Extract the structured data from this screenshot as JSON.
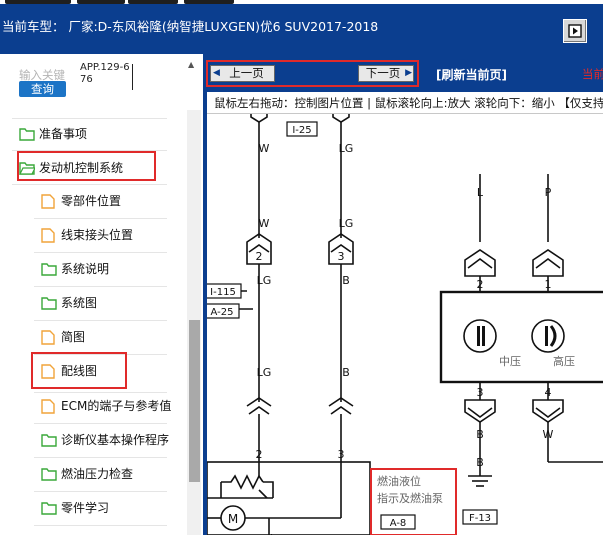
{
  "header": {
    "title": "当前车型： 厂家:D-东风裕隆(纳智捷LUXGEN)优6 SUV2017-2018"
  },
  "search": {
    "label": "输入关键",
    "code": "APP.129-676",
    "button": "查询"
  },
  "sidebar": {
    "items": [
      {
        "label": "准备事项",
        "icon": "folder-icon"
      },
      {
        "label": "发动机控制系统",
        "icon": "folder-open-icon"
      },
      {
        "label": "零部件位置",
        "icon": "document-icon"
      },
      {
        "label": "线束接头位置",
        "icon": "document-icon"
      },
      {
        "label": "系统说明",
        "icon": "folder-icon"
      },
      {
        "label": "系统图",
        "icon": "folder-icon"
      },
      {
        "label": "简图",
        "icon": "document-icon"
      },
      {
        "label": "配线图",
        "icon": "document-icon"
      },
      {
        "label": "ECM的端子与参考值",
        "icon": "document-icon"
      },
      {
        "label": "诊断仪基本操作程序",
        "icon": "folder-icon"
      },
      {
        "label": "燃油压力检查",
        "icon": "folder-icon"
      },
      {
        "label": "零件学习",
        "icon": "folder-icon"
      }
    ]
  },
  "toolbar": {
    "prev": "上一页",
    "next": "下一页",
    "refresh": "[刷新当前页]",
    "current": "当前"
  },
  "hint": "鼠标左右拖动：控制图片位置 | 鼠标滚轮向上:放大  滚轮向下：缩小 【仅支持IE浏览器】",
  "diagram": {
    "connectors": {
      "top": "I-25",
      "mid_left": "I-115",
      "mid_left2": "A-25",
      "bottom_part": "A-8",
      "ground": "F-13"
    },
    "wires": {
      "w1": "W",
      "w2": "LG",
      "w3": "W",
      "w4": "LG",
      "w5": "LG",
      "w6": "B",
      "w7": "LG",
      "w8": "B",
      "w9": "L",
      "w10": "P",
      "w11": "B",
      "w12": "W",
      "w13": "B",
      "w14": "L"
    },
    "pins": {
      "p1": "2",
      "p2": "3",
      "p3": "2",
      "p4": "3",
      "p5": "2",
      "p6": "3",
      "p7": "1",
      "p8": "2",
      "p9": "1",
      "p10": "3",
      "p11": "4"
    },
    "labels": {
      "mid_pressure": "中压",
      "high_pressure": "高压",
      "fuel_level_line1": "燃油液位",
      "fuel_level_line2": "指示及燃油泵",
      "motor": "M"
    }
  },
  "colors": {
    "header_bg": "#0b3e8f",
    "highlight": "#e02a2a",
    "search_button": "#1c74c6",
    "folder_green": "#3aa83a",
    "document_orange": "#f1a43a"
  }
}
